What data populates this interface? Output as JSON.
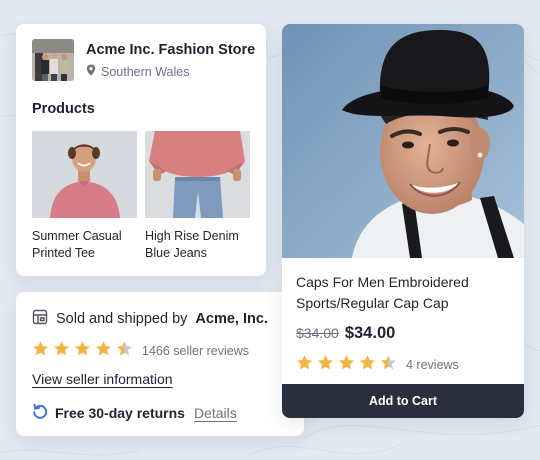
{
  "store": {
    "name": "Acme Inc. Fashion Store",
    "location": "Southern Wales",
    "products_heading": "Products",
    "products": [
      {
        "name": "Summer Casual Printed Tee"
      },
      {
        "name": "High Rise Denim Blue Jeans"
      }
    ]
  },
  "seller": {
    "sold_prefix": "Sold and shipped by",
    "seller_name": "Acme, Inc.",
    "rating": 4.5,
    "reviews_text": "1466 seller reviews",
    "view_link": "View seller information",
    "returns_text": "Free 30-day returns",
    "details_link": "Details"
  },
  "product": {
    "title": "Caps For Men Embroidered Sports/Regular Cap Cap",
    "old_price": "$34.00",
    "price": "$34.00",
    "rating": 4.5,
    "reviews_text": "4 reviews",
    "cart_label": "Add to Cart"
  },
  "colors": {
    "star": "#f2b640",
    "star_empty": "#c5cad3",
    "button": "#2b2f3d",
    "return_icon": "#3a78d6"
  },
  "icons": {
    "location": "map-pin-icon",
    "store": "storefront-icon",
    "returns": "return-arrow-icon",
    "star": "star-icon"
  }
}
